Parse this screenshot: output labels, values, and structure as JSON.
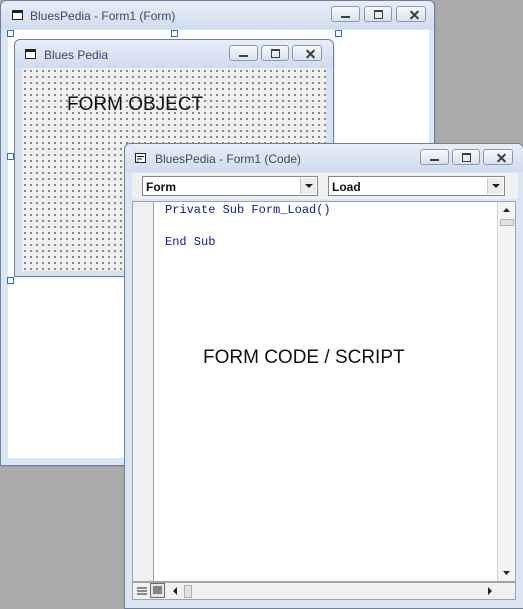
{
  "form_window": {
    "title": "BluesPedia - Form1 (Form)"
  },
  "form_object": {
    "title": "Blues Pedia",
    "caption": "FORM OBJECT"
  },
  "code_window": {
    "title": "BluesPedia - Form1 (Code)",
    "object_combo": "Form",
    "procedure_combo": "Load",
    "code_lines": [
      "Private Sub Form_Load()",
      "End Sub"
    ],
    "caption": "FORM CODE / SCRIPT"
  },
  "colors": {
    "desktop": "#ababab",
    "code_keyword": "#0b1a8c",
    "window_frame": "#dbe6f4"
  },
  "icons": [
    "form-icon",
    "code-window-icon",
    "minimize-icon",
    "maximize-icon",
    "close-icon",
    "scroll-up-icon",
    "scroll-down-icon",
    "scroll-left-icon",
    "scroll-right-icon",
    "procedure-view-icon",
    "full-module-view-icon"
  ]
}
